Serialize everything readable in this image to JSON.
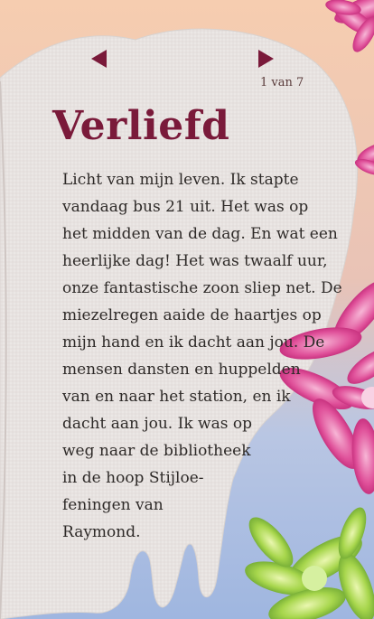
{
  "navigation": {
    "previous_icon": "triangle-left-icon",
    "next_icon": "triangle-right-icon",
    "page_counter": "1 van 7"
  },
  "poem": {
    "title": "Verliefd",
    "lines": [
      "Licht van mijn leven. Ik stapte",
      "vandaag bus 21 uit. Het was op",
      "het midden van de dag. En wat een",
      "heerlijke dag! Het was twaalf uur,",
      "onze fantastische zoon sliep net. De",
      "miezelregen aaide de haartjes op",
      "mijn hand en ik dacht aan jou. De",
      "mensen dansten en huppelden",
      "van en naar het station, en ik",
      "dacht aan jou. Ik was op",
      "weg naar de bibliotheek",
      "in de hoop Stijloe-",
      "feningen van",
      "Raymond."
    ]
  },
  "colors": {
    "accent": "#7a1a3a",
    "background_top": "#f4c9a8",
    "background_bottom": "#a9bde0",
    "paper": "#ece8e6",
    "flower_pink": "#d63f8c",
    "flower_green": "#8cc63f"
  }
}
